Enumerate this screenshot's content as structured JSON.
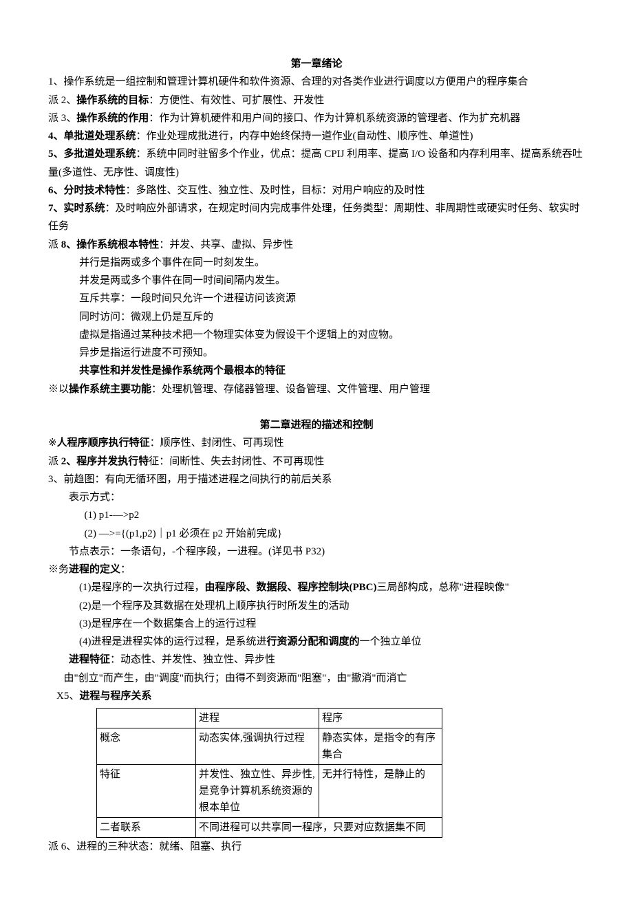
{
  "ch1": {
    "title": "第一章绪论",
    "p1": "1、操作系统是一组控制和管理计算机硬件和软件资源、合理的对各类作业进行调度以方便用户的程序集合",
    "p2a": "派 2、",
    "p2b": "操作系统的目标",
    "p2c": "：方便性、有效性、可扩展性、开发性",
    "p3a": "派 3、",
    "p3b": "操作系统的作用",
    "p3c": "：作为计算机硬件和用户间的接口、作为计算机系统资源的管理者、作为扩充机器",
    "p4a": "4",
    "p4b": "、单批道处理系统",
    "p4c": "：作业处理成批进行，内存中始终保持一道作业(自动性、顺序性、单道性)",
    "p5a": "5",
    "p5b": "、多批道处理系统",
    "p5c": "：系统中同时驻留多个作业，优点：提高 CPIJ 利用率、提高 I/O 设备和内存利用率、提高系统吞吐量(多道性、无序性、调度性)",
    "p6a": "6",
    "p6b": "、分时技术特性",
    "p6c": "：多路性、交互性、独立性、及时性，目标：对用户响应的及时性",
    "p7a": "7",
    "p7b": "、实时系统",
    "p7c": "：及时响应外部请求，在规定时间内完成事件处理，任务类型：周期性、非周期性或硬实时任务、软实时任务",
    "p8a": "派 ",
    "p8b": "8",
    "p8c": "、操作系统根本特性",
    "p8d": "：并发、共享、虚拟、异步性",
    "p8_1": "并行是指两或多个事件在同一时刻发生。",
    "p8_2": "并发是两或多个事件在同一时间间隔内发生。",
    "p8_3": "互斥共享：一段时间只允许一个进程访问该资源",
    "p8_4": "同时访问：微观上仍是互斥的",
    "p8_5": "虚拟是指通过某种技术把一个物理实体变为假设干个逻辑上的对应物。",
    "p8_6": "异步是指运行进度不可预知。",
    "p8_7": "共享性和并发性是操作系统两个最根本的特征",
    "p9a": "※以",
    "p9b": "操作系统主要功能",
    "p9c": "：处理机管理、存储器管理、设备管理、文件管理、用户管理"
  },
  "ch2": {
    "title": "第二章进程的描述和控制",
    "p1a": "※",
    "p1b": "人程序顺序执行特征",
    "p1c": "：顺序性、封闭性、可再现性",
    "p2a": "派 ",
    "p2b": "2",
    "p2c": "、程序并发执行特",
    "p2d": "征：间断性、失去封闭性、不可再现性",
    "p3": "3、前趋图：有向无循环图，用于描述进程之间执行的前后关系",
    "p3_1": "表示方式：",
    "p3_2": "(1)  p1-—>p2",
    "p3_3": "(2)  —>={(p1,p2)｜p1 必须在 p2 开始前完成}",
    "p3_4": "节点表示：一条语句，-个程序段，一进程。(详见书 P32)",
    "p4a": "※务",
    "p4b": "进程的定义",
    "p4c": "：",
    "p4_1a": "(1)是程序的一次执行过程，",
    "p4_1b": "由程序段、数据段、程序控制块(PBC)",
    "p4_1c": "三局部构成，总称\"进程映像\"",
    "p4_2": "(2)是一个程序及其数据在处理机上顺序执行时所发生的活动",
    "p4_3": "(3)是程序在一个数据集合上的运行过程",
    "p4_4a": "(4)进程是进程实体的运行过程，是系统进",
    "p4_4b": "行资源分配和调度的",
    "p4_4c": "一个独立单位",
    "p4_5a": "进程特征",
    "p4_5b": "：动态性、并发性、独立性、异步性",
    "p4_6": "由\"创立\"而产生，由\"调度\"而执行；由得不到资源而\"阻塞\"，由\"撤消\"而消亡",
    "p5a": "X5、",
    "p5b": "进程与程序关系",
    "table": {
      "h1": "进程",
      "h2": "程序",
      "r1a": "概念",
      "r1b": "动态实体,强调执行过程",
      "r1c": "静态实体，是指令的有序集合",
      "r2a": "特征",
      "r2b": "并发性、独立性、异步性,是竞争计算机系统资源的根本单位",
      "r2c": "无并行特性，是静止的",
      "r3a": "二者联系",
      "r3b": "不同进程可以共享同一程序，只要对应数据集不同"
    },
    "p6": "派 6、进程的三种状态：就绪、阻塞、执行"
  }
}
